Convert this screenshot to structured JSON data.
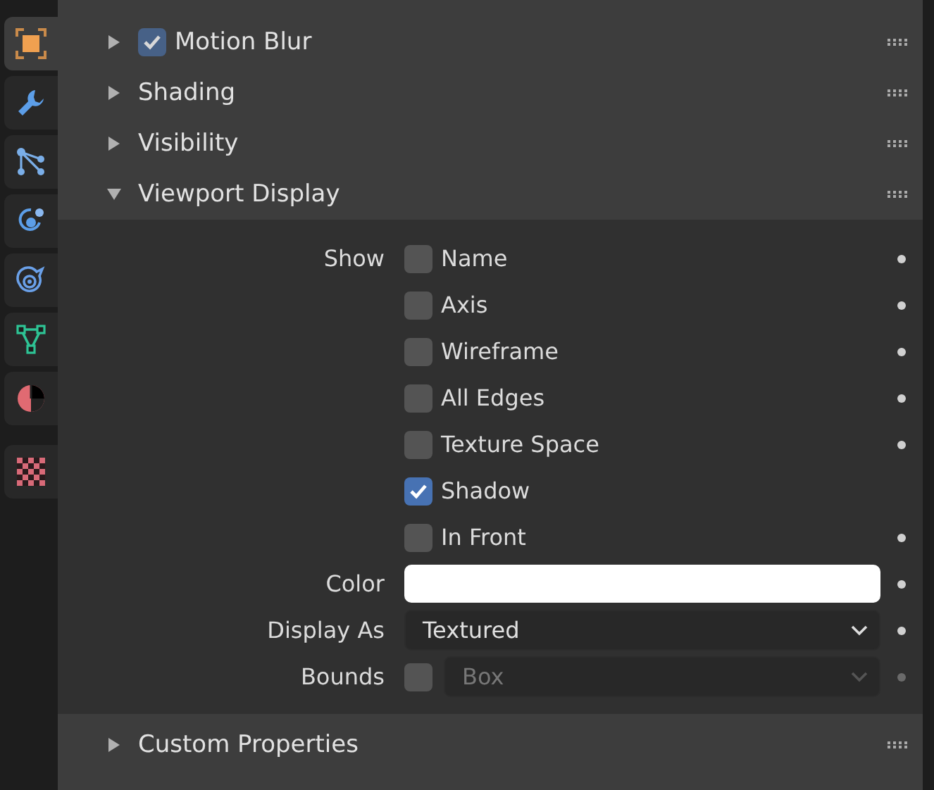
{
  "tabs": [
    {
      "kind": "object",
      "selected": true
    },
    {
      "kind": "modifiers",
      "selected": false
    },
    {
      "kind": "particles",
      "selected": false
    },
    {
      "kind": "physics",
      "selected": false
    },
    {
      "kind": "constraints",
      "selected": false
    },
    {
      "kind": "data",
      "selected": false
    },
    {
      "kind": "material",
      "selected": false
    },
    {
      "kind": "texture",
      "selected": false
    }
  ],
  "panels_top": [
    {
      "title": "Motion Blur",
      "expanded": false,
      "checkbox": true,
      "checked": true
    },
    {
      "title": "Shading",
      "expanded": false
    },
    {
      "title": "Visibility",
      "expanded": false
    },
    {
      "title": "Viewport Display",
      "expanded": true
    }
  ],
  "viewport_display": {
    "show_label": "Show",
    "show_options": [
      {
        "label": "Name",
        "checked": false,
        "keyframe_dot": true
      },
      {
        "label": "Axis",
        "checked": false,
        "keyframe_dot": true
      },
      {
        "label": "Wireframe",
        "checked": false,
        "keyframe_dot": true
      },
      {
        "label": "All Edges",
        "checked": false,
        "keyframe_dot": true
      },
      {
        "label": "Texture Space",
        "checked": false,
        "keyframe_dot": true
      },
      {
        "label": "Shadow",
        "checked": true,
        "keyframe_dot": false
      },
      {
        "label": "In Front",
        "checked": false,
        "keyframe_dot": true
      }
    ],
    "color": {
      "label": "Color",
      "color": "#ffffff"
    },
    "display_as": {
      "label": "Display As",
      "value": "Textured"
    },
    "bounds": {
      "label": "Bounds",
      "checked": false,
      "value": "Box",
      "disabled": true
    }
  },
  "panels_bottom": [
    {
      "title": "Custom Properties",
      "expanded": false
    }
  ]
}
